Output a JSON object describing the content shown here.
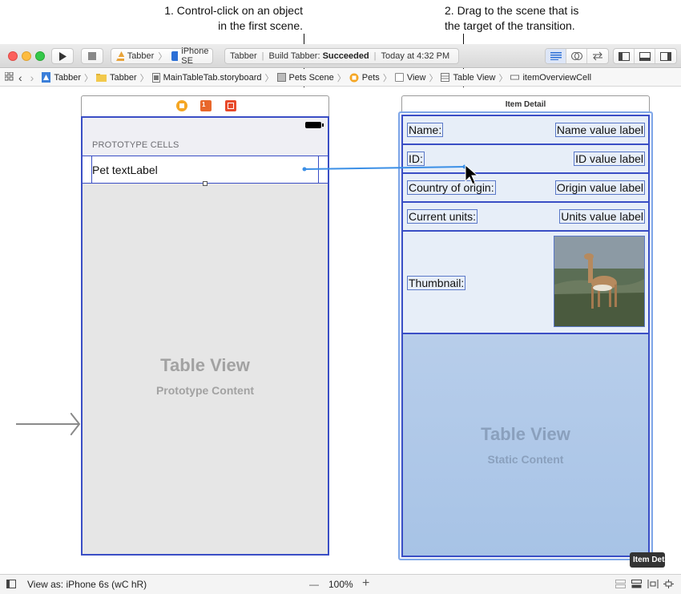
{
  "annotations": {
    "step1_line1": "1. Control-click on an object",
    "step1_line2": "in the first scene.",
    "step2_line1": "2. Drag to the scene that is",
    "step2_line2": "the target of the transition."
  },
  "toolbar": {
    "scheme_app": "Tabber",
    "scheme_device": "iPhone SE",
    "status_project": "Tabber",
    "status_prefix": "Build Tabber:",
    "status_result": "Succeeded",
    "status_time": "Today at 4:32 PM"
  },
  "jumpbar": {
    "items": [
      "Tabber",
      "Tabber",
      "MainTableTab.storyboard",
      "Pets Scene",
      "Pets",
      "View",
      "Table View",
      "itemOverviewCell"
    ]
  },
  "scene1": {
    "section_header": "PROTOTYPE CELLS",
    "cell_label": "Pet textLabel",
    "table_title": "Table View",
    "table_subtitle": "Prototype Content"
  },
  "scene2": {
    "title": "Item Detail",
    "rows": [
      {
        "label": "Name:",
        "value": "Name value label"
      },
      {
        "label": "ID:",
        "value": "ID value label"
      },
      {
        "label": "Country of origin:",
        "value": "Origin value label"
      },
      {
        "label": "Current units:",
        "value": "Units value label"
      },
      {
        "label": "Thumbnail:",
        "value": ""
      }
    ],
    "table_title": "Table View",
    "table_subtitle": "Static Content",
    "tooltip": "Item Detail"
  },
  "bottombar": {
    "view_as": "View as: iPhone 6s (wC hR)",
    "zoom": "100%",
    "zoom_out": "—",
    "zoom_in": "+"
  },
  "colors": {
    "selection_blue": "#3a4ec5",
    "drag_line": "#3b8fe6",
    "success": "#222222"
  }
}
